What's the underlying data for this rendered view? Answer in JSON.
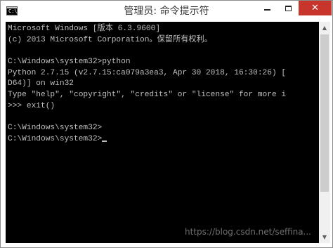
{
  "window": {
    "title": "管理员: 命令提示符",
    "icon": "cmd-icon",
    "icon_text": "C:\\_"
  },
  "controls": {
    "minimize": "minimize-icon",
    "maximize": "maximize-icon",
    "close": "✕"
  },
  "console": {
    "lines": [
      "Microsoft Windows [版本 6.3.9600]",
      "(c) 2013 Microsoft Corporation。保留所有权利。",
      "",
      "C:\\Windows\\system32>python",
      "Python 2.7.15 (v2.7.15:ca079a3ea3, Apr 30 2018, 16:30:26) [",
      "D64)] on win32",
      "Type \"help\", \"copyright\", \"credits\" or \"license\" for more i",
      ">>> exit()",
      "",
      "C:\\Windows\\system32>",
      "C:\\Windows\\system32>"
    ]
  },
  "watermark": "https://blog.csdn.net/seffina..."
}
